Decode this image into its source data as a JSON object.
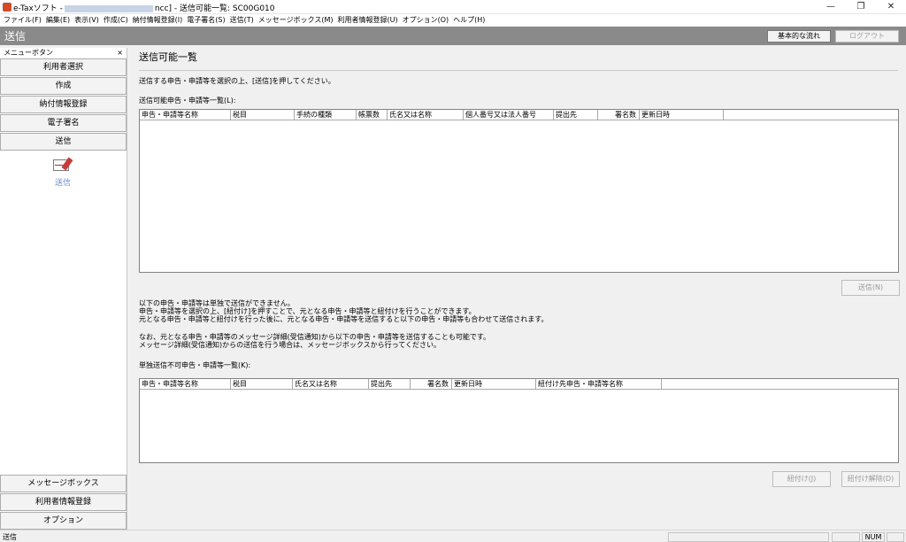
{
  "window": {
    "title_prefix": "e-Taxソフト -",
    "title_suffix": "ncc] - 送信可能一覧: SC00G010",
    "minimize_glyph": "—",
    "maximize_glyph": "❐",
    "close_glyph": "✕"
  },
  "menu": [
    "ファイル(F)",
    "編集(E)",
    "表示(V)",
    "作成(C)",
    "納付情報登録(I)",
    "電子署名(S)",
    "送信(T)",
    "メッセージボックス(M)",
    "利用者情報登録(U)",
    "オプション(O)",
    "ヘルプ(H)"
  ],
  "header": {
    "title": "送信",
    "flow_button": "基本的な流れ",
    "logout_button": "ログアウト"
  },
  "sidebar": {
    "header": "メニューボタン",
    "close": "×",
    "top_buttons": [
      "利用者選択",
      "作成",
      "納付情報登録",
      "電子署名",
      "送信"
    ],
    "icon_label": "送信",
    "icon_name": "send-envelope-icon",
    "bottom_buttons": [
      "メッセージボックス",
      "利用者情報登録",
      "オプション"
    ]
  },
  "main": {
    "title": "送信可能一覧",
    "instruction": "送信する申告・申請等を選択の上、[送信]を押してください。",
    "list1_label": "送信可能申告・申請等一覧(L):",
    "list1_columns": [
      "申告・申請等名称",
      "税目",
      "手続の種類",
      "帳票数",
      "氏名又は名称",
      "個人番号又は法人番号",
      "提出先",
      "署名数",
      "更新日時"
    ],
    "send_button": "送信(N)",
    "notes": [
      "以下の申告・申請等は単独で送信ができません。",
      "申告・申請等を選択の上、[紐付け]を押すことで、元となる申告・申請等と紐付けを行うことができます。",
      "元となる申告・申請等と紐付けを行った後に、元となる申告・申請等を送信すると以下の申告・申請等も合わせて送信されます。",
      "なお、元となる申告・申請等のメッセージ詳細(受信通知)から以下の申告・申請等を送信することも可能です。",
      "メッセージ詳細(受信通知)からの送信を行う場合は、メッセージボックスから行ってください。"
    ],
    "list2_label": "単独送信不可申告・申請等一覧(K):",
    "list2_columns": [
      "申告・申請等名称",
      "税目",
      "氏名又は名称",
      "提出先",
      "署名数",
      "更新日時",
      "紐付け先申告・申請等名称"
    ],
    "link_button": "紐付け(J)",
    "unlink_button": "紐付け解除(D)"
  },
  "status": {
    "text": "送信",
    "num": "NUM"
  }
}
